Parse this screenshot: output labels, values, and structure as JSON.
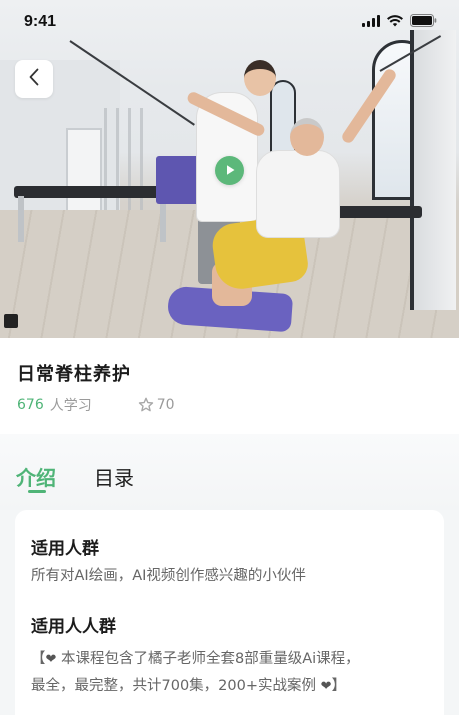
{
  "status_bar": {
    "time": "9:41"
  },
  "video": {
    "back_icon": "chevron-left-icon",
    "play_icon": "play-icon",
    "accent_color": "#5cb87a"
  },
  "course": {
    "title": "日常脊柱养护",
    "learners_count": "676",
    "learners_label": "人学习",
    "rating_icon": "star-outline-icon",
    "rating_value": "70"
  },
  "tabs": [
    {
      "label": "介绍",
      "active": true
    },
    {
      "label": "目录",
      "active": false
    }
  ],
  "intro": {
    "section1_heading": "适用人群",
    "section1_text": "所有对AI绘画，AI视频创作感兴趣的小伙伴",
    "section2_heading": "适用人人群",
    "section2_line1_prefix": "【",
    "section2_line1_text": " 本课程包含了橘子老师全套8部重量级Ai课程，",
    "section2_line2_text": "最全，最完整，共计700集，200+实战案例 ",
    "section2_line2_suffix": "】",
    "heart_icon": "heart-icon",
    "heart_glyph": "❤"
  },
  "colors": {
    "brand_green": "#4fb477",
    "text_secondary": "#9a9a9a"
  }
}
